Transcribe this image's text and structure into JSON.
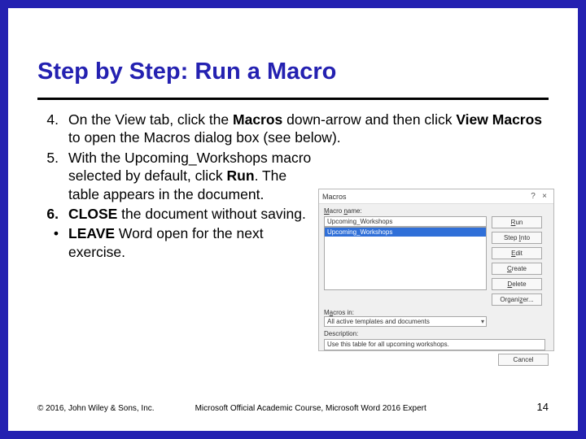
{
  "title": "Step by Step: Run a Macro",
  "steps": {
    "s4": {
      "num": "4.",
      "pre": "On the View tab, click the ",
      "b1": "Macros",
      "mid": " down-arrow and then click ",
      "b2": "View Macros",
      "post": " to open the Macros dialog box (see below)."
    },
    "s5": {
      "num": "5.",
      "pre": "With the Upcoming_Workshops macro selected by default, click ",
      "b1": "Run",
      "post": ". The table appears in the document."
    },
    "s6": {
      "num": "6.",
      "b1": "CLOSE",
      "post": " the document without saving."
    },
    "s7": {
      "num": "•",
      "b1": "LEAVE",
      "post": " Word open for the next exercise."
    }
  },
  "dialog": {
    "title": "Macros",
    "name_label": "Macro name:",
    "name_value": "Upcoming_Workshops",
    "selected_item": "Upcoming_Workshops",
    "buttons": {
      "run": "Run",
      "stepinto_pre": "Step ",
      "stepinto_u": "I",
      "stepinto_post": "nto",
      "edit_u": "E",
      "edit_post": "dit",
      "create_u": "C",
      "create_post": "reate",
      "delete_u": "D",
      "delete_post": "elete",
      "org": "Organizer...",
      "cancel": "Cancel"
    },
    "macros_in_label_pre": "M",
    "macros_in_label_post": "acros in:",
    "macros_in_value": "All active templates and documents",
    "desc_label": "Description:",
    "desc_value": "Use this table for all upcoming workshops."
  },
  "footer": {
    "left": "© 2016, John Wiley & Sons, Inc.",
    "center": "Microsoft Official Academic Course, Microsoft Word 2016 Expert",
    "right": "14"
  }
}
